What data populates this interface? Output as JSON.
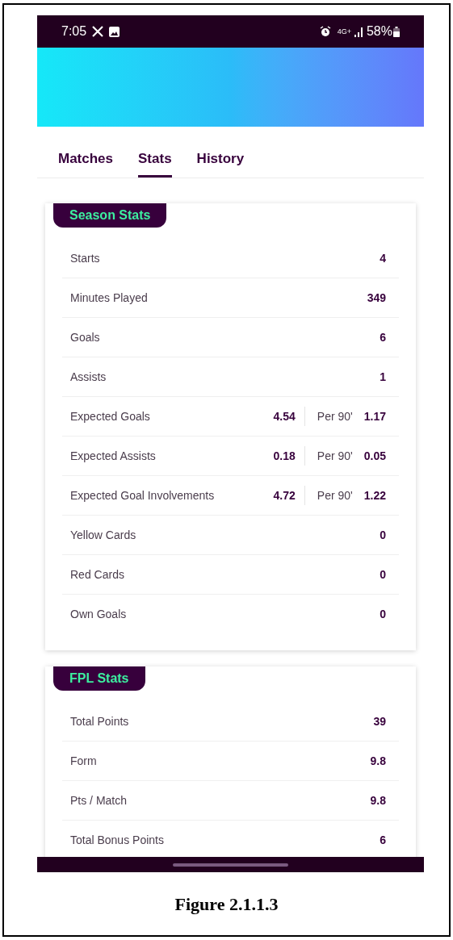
{
  "status_bar": {
    "time": "7:05",
    "network": "4G+",
    "battery": "58%"
  },
  "tabs": [
    {
      "label": "Matches",
      "selected": false
    },
    {
      "label": "Stats",
      "selected": true
    },
    {
      "label": "History",
      "selected": false
    }
  ],
  "sections": [
    {
      "title": "Season Stats",
      "rows": [
        {
          "label": "Starts",
          "value": "4"
        },
        {
          "label": "Minutes Played",
          "value": "349"
        },
        {
          "label": "Goals",
          "value": "6"
        },
        {
          "label": "Assists",
          "value": "1"
        },
        {
          "label": "Expected Goals",
          "value": "4.54",
          "per90_label": "Per 90'",
          "per90_value": "1.17"
        },
        {
          "label": "Expected Assists",
          "value": "0.18",
          "per90_label": "Per 90'",
          "per90_value": "0.05"
        },
        {
          "label": "Expected Goal Involvements",
          "value": "4.72",
          "per90_label": "Per 90'",
          "per90_value": "1.22"
        },
        {
          "label": "Yellow Cards",
          "value": "0"
        },
        {
          "label": "Red Cards",
          "value": "0"
        },
        {
          "label": "Own Goals",
          "value": "0"
        }
      ]
    },
    {
      "title": "FPL Stats",
      "rows": [
        {
          "label": "Total Points",
          "value": "39"
        },
        {
          "label": "Form",
          "value": "9.8"
        },
        {
          "label": "Pts / Match",
          "value": "9.8"
        },
        {
          "label": "Total Bonus Points",
          "value": "6"
        }
      ]
    }
  ],
  "caption": "Figure 2.1.1.3"
}
